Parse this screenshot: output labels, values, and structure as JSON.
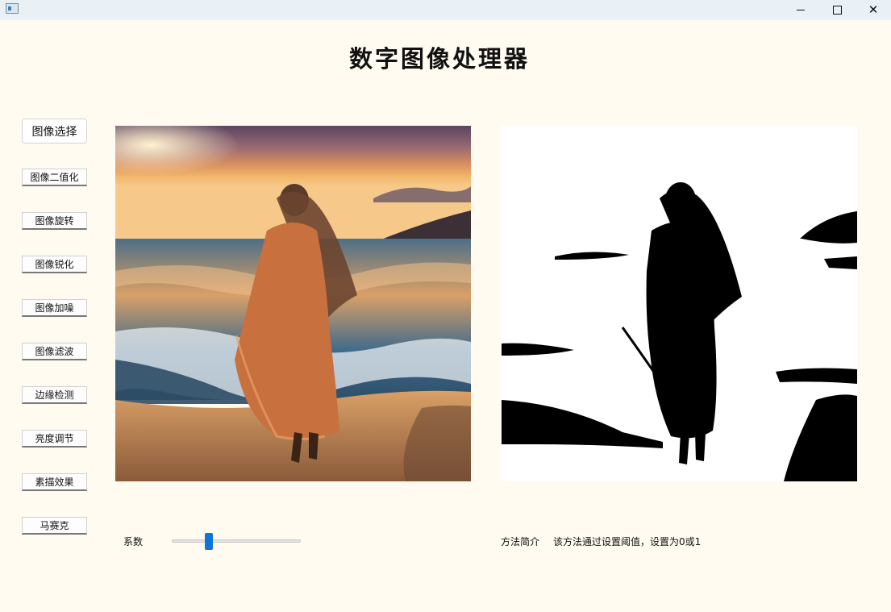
{
  "window": {
    "minimize": "—",
    "close": "✕"
  },
  "app": {
    "title": "数字图像处理器"
  },
  "sidebar": {
    "select_label": "图像选择",
    "items": [
      {
        "label": "图像二值化"
      },
      {
        "label": "图像旋转"
      },
      {
        "label": "图像锐化"
      },
      {
        "label": "图像加噪"
      },
      {
        "label": "图像滤波"
      },
      {
        "label": "边缘检测"
      },
      {
        "label": "亮度调节"
      },
      {
        "label": "素描效果"
      },
      {
        "label": "马赛克"
      }
    ]
  },
  "controls": {
    "slider_label": "系数",
    "slider_value_fraction": 0.27,
    "method_label": "方法简介",
    "method_text": "该方法通过设置阈值，设置为0或1"
  },
  "images": {
    "original": "beach-sunset-woman-photo",
    "processed": "binarized-silhouette-photo"
  },
  "colors": {
    "accent": "#0f74d6",
    "background": "#fffbf1",
    "titlebar": "#e9f1f7"
  }
}
